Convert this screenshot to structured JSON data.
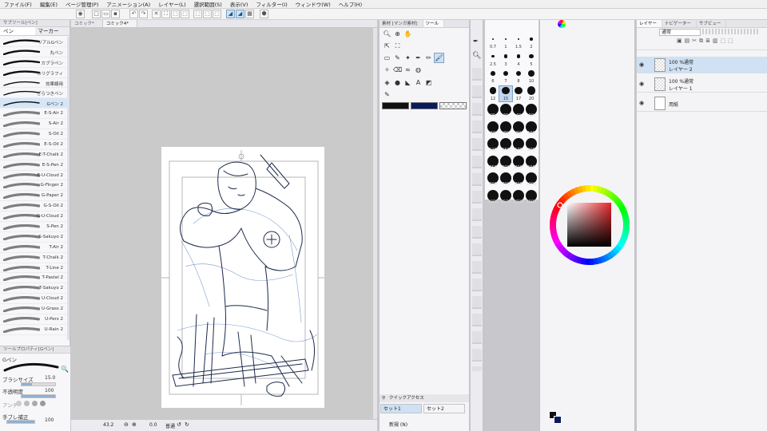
{
  "menu": [
    "ファイル(F)",
    "編集(E)",
    "ページ管理(P)",
    "アニメーション(A)",
    "レイヤー(L)",
    "選択範囲(S)",
    "表示(V)",
    "フィルター(I)",
    "ウィンドウ(W)",
    "ヘルプ(H)"
  ],
  "left_panel": {
    "header": "サブツール[ペン]",
    "tabs": [
      "ペン",
      "マーカー"
    ],
    "brushes": [
      "リアルGペン",
      "丸ペン",
      "カブラペン",
      "カリグラフィ",
      "効果線用",
      "ざらつきペン",
      "Gペン 2",
      "E-S-Air 2",
      "S-Air 2",
      "S-Oil 2",
      "E-S-Oil 2",
      "E-T-Chalk 2",
      "E-S-Pen 2",
      "E-U-Cloud 2",
      "G-Finger 2",
      "G-Paper 2",
      "G-S-Oil 2",
      "G-U-Cloud 2",
      "S-Pen 2",
      "S-Sakuyo 2",
      "T-Air 2",
      "T-Chalk 2",
      "T-Line 2",
      "T-Pastel 2",
      "T-Sakuyo 2",
      "U-Cloud 2",
      "U-Grass 2",
      "U-Pers 2",
      "U-Rain 2"
    ],
    "selected_brush": "Gペン 2",
    "tool_property": {
      "header": "ツールプロパティ[Gペン]",
      "name": "Gペン",
      "brush_size_label": "ブラシサイズ",
      "brush_size_value": "15.0",
      "opacity_label": "不透明度",
      "opacity_value": "100",
      "aa_label": "アンチ",
      "stabilize_label": "手ブレ補正",
      "stabilize_value": "100"
    }
  },
  "document_tabs": [
    "コミック*",
    "コミック4*"
  ],
  "canvas_status": {
    "zoom": "43.2",
    "angle": "0.0",
    "mode": "普通"
  },
  "tool_panel": {
    "tabs": [
      "素材 [マンガ素材]",
      "ツール"
    ],
    "quick_access": "クイックアクセス",
    "sets": [
      "セット1",
      "セット2"
    ],
    "footer_text": "新規 (N)",
    "main_color": "#111111",
    "sub_color": "#0a1b5c"
  },
  "brush_sizes": [
    "0.7",
    "1",
    "1.5",
    "2",
    "2.5",
    "3",
    "4",
    "5",
    "6",
    "7",
    "8",
    "10",
    "12",
    "15",
    "17",
    "20",
    "25",
    "30",
    "40",
    "50",
    "60",
    "70",
    "80",
    "100",
    "120",
    "150",
    "170",
    "200",
    "250",
    "300",
    "400",
    "500",
    "600",
    "700",
    "800",
    "1000",
    "1200",
    "1500",
    "1700",
    "2000"
  ],
  "selected_size": "15",
  "layer_panel": {
    "tabs": [
      "レイヤー",
      "ナビゲーター",
      "サブビュー"
    ],
    "blend_mode": "通常",
    "layers": [
      {
        "name": "レイヤー 2",
        "meta": "100 %通常",
        "selected": true,
        "type": "raster"
      },
      {
        "name": "レイヤー 1",
        "meta": "100 %通常",
        "selected": false,
        "type": "raster"
      },
      {
        "name": "用紙",
        "meta": "",
        "selected": false,
        "type": "paper"
      }
    ]
  },
  "colors": {
    "ring_base": "#ff0000",
    "square_hue": "#e8262a",
    "accent": "#7aa2c8"
  }
}
